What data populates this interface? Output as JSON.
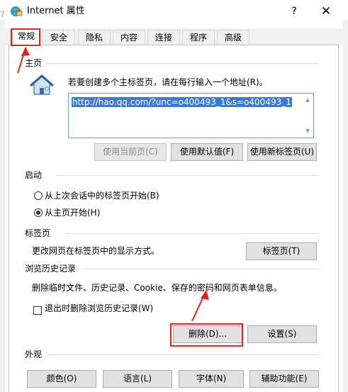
{
  "window": {
    "title": "Internet 属性",
    "help_label": "?",
    "close_label": "✕",
    "icon": "internet-options-icon",
    "edge_glyph": "7"
  },
  "tabs": [
    {
      "label": "常规",
      "active": true
    },
    {
      "label": "安全",
      "active": false
    },
    {
      "label": "隐私",
      "active": false
    },
    {
      "label": "内容",
      "active": false
    },
    {
      "label": "连接",
      "active": false
    },
    {
      "label": "程序",
      "active": false
    },
    {
      "label": "高级",
      "active": false
    }
  ],
  "homepage": {
    "header": "主页",
    "icon": "home-icon",
    "instruction": "若要创建多个主标签页，请在每行输入一个地址(R)。",
    "url": "http://hao.qq.com/?unc=o400493_1&s=o400493_1",
    "buttons": {
      "use_current": "使用当前页(C)",
      "use_default": "使用默认值(F)",
      "use_new_tab": "使用新标签页(U)"
    }
  },
  "startup": {
    "header": "启动",
    "option_last_session": "从上次会话中的标签页开始(B)",
    "option_homepage": "从主页开始(H)",
    "selected": "homepage"
  },
  "tabs_section": {
    "header": "标签页",
    "description": "更改网页在标签页中的显示方式。",
    "button": "标签页(T)"
  },
  "history": {
    "header": "浏览历史记录",
    "description": "删除临时文件、历史记录、Cookie、保存的密码和网页表单信息。",
    "checkbox_label": "退出时删除浏览历史记录(W)",
    "checkbox_checked": false,
    "delete_button": "删除(D)...",
    "settings_button": "设置(S)"
  },
  "appearance": {
    "header": "外观",
    "colors_button": "颜色(O)",
    "languages_button": "语言(L)",
    "fonts_button": "字体(N)",
    "accessibility_button": "辅助功能(E)"
  },
  "colors": {
    "highlight": "#d9241f",
    "selection": "#3b78d8"
  }
}
